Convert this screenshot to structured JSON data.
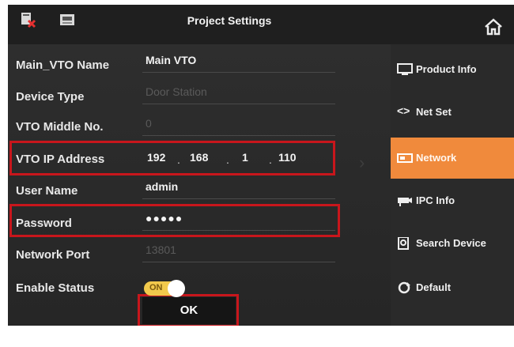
{
  "window": {
    "title": "Project Settings"
  },
  "form": {
    "vto_name": {
      "label": "Main_VTO Name",
      "value": "Main VTO"
    },
    "device_type": {
      "label": "Device Type",
      "value": "Door Station"
    },
    "vto_middle_no": {
      "label": "VTO Middle No.",
      "value": "0"
    },
    "vto_ip": {
      "label": "VTO IP Address",
      "segments": [
        "192",
        "168",
        "1",
        "110"
      ],
      "separator": "."
    },
    "user_name": {
      "label": "User Name",
      "value": "admin"
    },
    "password": {
      "label": "Password",
      "value": "●●●●●"
    },
    "network_port": {
      "label": "Network Port",
      "value": "13801"
    },
    "enable_status": {
      "label": "Enable Status",
      "toggle_label": "ON",
      "enabled": true
    }
  },
  "buttons": {
    "ok_label": "OK"
  },
  "sidebar": {
    "items": [
      {
        "label": "Product Info",
        "icon": "monitor-icon",
        "active": false
      },
      {
        "label": "Net Set",
        "icon": "code-brackets-icon",
        "active": false
      },
      {
        "label": "Network",
        "icon": "network-card-icon",
        "active": true
      },
      {
        "label": "IPC Info",
        "icon": "camera-icon",
        "active": false
      },
      {
        "label": "Search Device",
        "icon": "search-device-icon",
        "active": false
      },
      {
        "label": "Default",
        "icon": "reset-icon",
        "active": false
      }
    ]
  },
  "colors": {
    "accent": "#f08a3c",
    "highlight_box": "#c8161c",
    "toggle": "#f2c94c",
    "background": "#2b2b2b"
  }
}
